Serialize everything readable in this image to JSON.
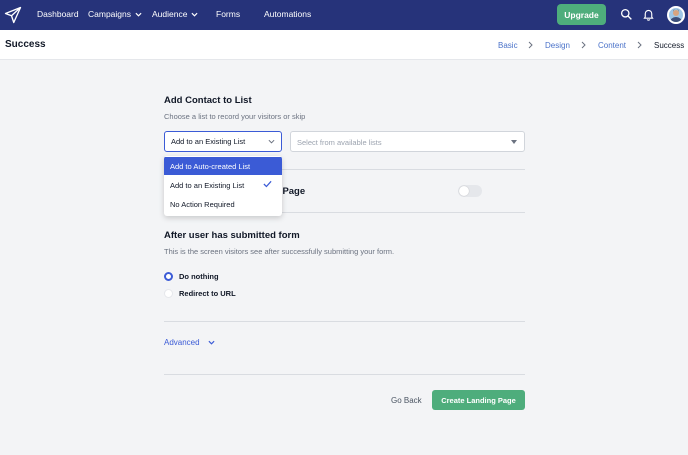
{
  "nav": {
    "items": [
      {
        "label": "Dashboard"
      },
      {
        "label": "Campaigns"
      },
      {
        "label": "Audience"
      },
      {
        "label": "Forms"
      },
      {
        "label": "Automations"
      }
    ],
    "upgrade_label": "Upgrade",
    "brand_color": "#26337a",
    "accent_color": "#4ead7c"
  },
  "header": {
    "title": "Success",
    "breadcrumb": [
      "Basic",
      "Design",
      "Content",
      "Success"
    ]
  },
  "contact_list": {
    "title": "Add Contact to List",
    "description": "Choose a list to record your visitors or skip",
    "selected": "Add to an Existing List",
    "available_placeholder": "Select from available lists",
    "options": [
      "Add to Auto-created List",
      "Add to an Existing List",
      "No Action Required"
    ]
  },
  "landing_toggle": {
    "label_visible": "g Page",
    "enabled": false
  },
  "after_submit": {
    "title": "After user has submitted form",
    "description": "This is the screen visitors see after successfully submitting your form.",
    "options": [
      {
        "label": "Do nothing",
        "checked": true
      },
      {
        "label": "Redirect to URL",
        "checked": false
      }
    ]
  },
  "advanced_label": "Advanced",
  "footer": {
    "back_label": "Go Back",
    "create_label": "Create Landing Page"
  }
}
